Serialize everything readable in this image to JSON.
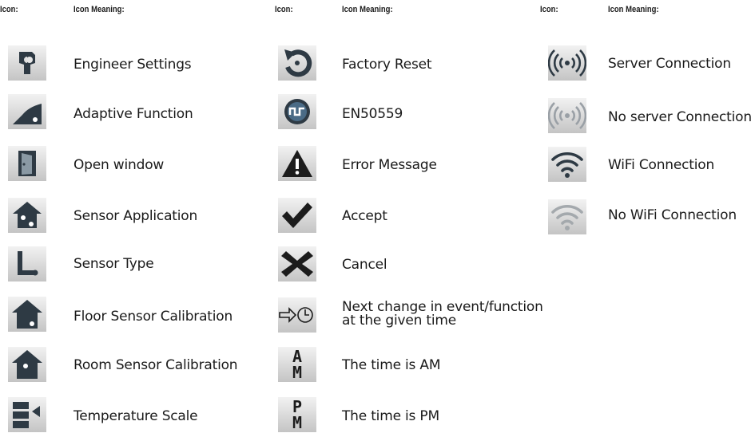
{
  "headers": {
    "col1": {
      "icon": "Icon:",
      "meaning": "Icon Meaning:"
    },
    "col2": {
      "icon": "Icon:",
      "meaning": "Icon Meaning:"
    },
    "col3": {
      "icon": "Icon:",
      "meaning": "Icon Meaning:"
    }
  },
  "col1": [
    {
      "icon": "wrench-icon",
      "label": "Engineer Settings"
    },
    {
      "icon": "ramp-icon",
      "label": "Adaptive Function"
    },
    {
      "icon": "open-door-icon",
      "label": "Open window"
    },
    {
      "icon": "house-sensor-icon",
      "label": "Sensor Application"
    },
    {
      "icon": "sensor-probe-icon",
      "label": "Sensor Type"
    },
    {
      "icon": "house-floor-sensor-icon",
      "label": "Floor Sensor Calibration"
    },
    {
      "icon": "house-room-sensor-icon",
      "label": "Room Sensor Calibration"
    },
    {
      "icon": "temperature-scale-icon",
      "label": "Temperature Scale"
    }
  ],
  "col2": [
    {
      "icon": "reset-arrow-icon",
      "label": "Factory Reset"
    },
    {
      "icon": "en50559-logo-icon",
      "label": "EN50559"
    },
    {
      "icon": "warning-triangle-icon",
      "label": "Error Message"
    },
    {
      "icon": "checkmark-icon",
      "label": "Accept"
    },
    {
      "icon": "cross-icon",
      "label": "Cancel"
    },
    {
      "icon": "arrow-clock-icon",
      "label_lines": [
        "Next change in event/function",
        "at the given time"
      ]
    },
    {
      "icon": "am-icon",
      "label": "The time is AM",
      "glyph": [
        "A",
        "M"
      ]
    },
    {
      "icon": "pm-icon",
      "label": "The time is PM",
      "glyph": [
        "P",
        "M"
      ]
    }
  ],
  "col3": [
    {
      "icon": "server-connection-icon",
      "label": "Server Connection"
    },
    {
      "icon": "no-server-connection-icon",
      "label": "No server Connection"
    },
    {
      "icon": "wifi-connection-icon",
      "label": "WiFi Connection"
    },
    {
      "icon": "no-wifi-connection-icon",
      "label": "No WiFi Connection"
    }
  ]
}
